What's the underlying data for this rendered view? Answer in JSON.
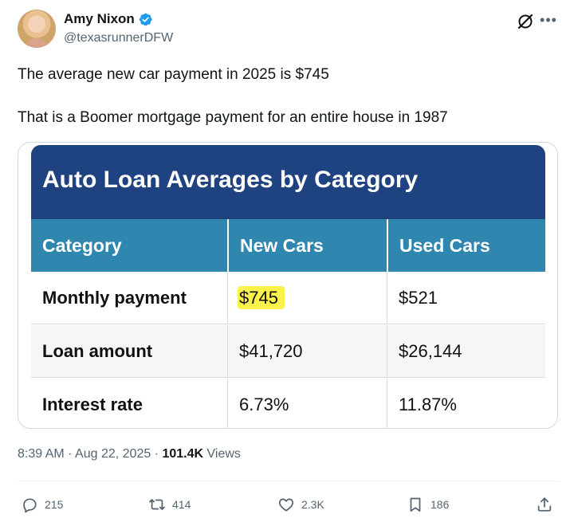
{
  "author": {
    "display_name": "Amy Nixon",
    "handle": "@texasrunnerDFW"
  },
  "icons": {
    "verified": "verified-badge-icon",
    "grok": "grok-icon",
    "more": "more-icon",
    "reply": "reply-icon",
    "retweet": "retweet-icon",
    "like": "like-icon",
    "bookmark": "bookmark-icon",
    "share": "share-icon"
  },
  "tweet": {
    "line1": "The average new car payment in 2025 is $745",
    "line2": "That is a Boomer mortgage payment for an entire house in 1987"
  },
  "image_table": {
    "title": "Auto Loan Averages by Category",
    "headers": [
      "Category",
      "New Cars",
      "Used Cars"
    ],
    "rows": [
      {
        "label": "Monthly payment",
        "new": "$745",
        "used": "$521"
      },
      {
        "label": "Loan amount",
        "new": "$41,720",
        "used": "$26,144"
      },
      {
        "label": "Interest rate",
        "new": "6.73%",
        "used": "11.87%"
      }
    ]
  },
  "meta": {
    "time": "8:39 AM",
    "date": "Aug 22, 2025",
    "views_count": "101.4K",
    "views_label": "Views"
  },
  "actions": {
    "replies": "215",
    "retweets": "414",
    "likes": "2.3K",
    "bookmarks": "186"
  },
  "colors": {
    "title_bg": "#1f4280",
    "header_bg": "#2f86ae",
    "highlight": "#fbf24a",
    "verified": "#1d9bf0"
  }
}
